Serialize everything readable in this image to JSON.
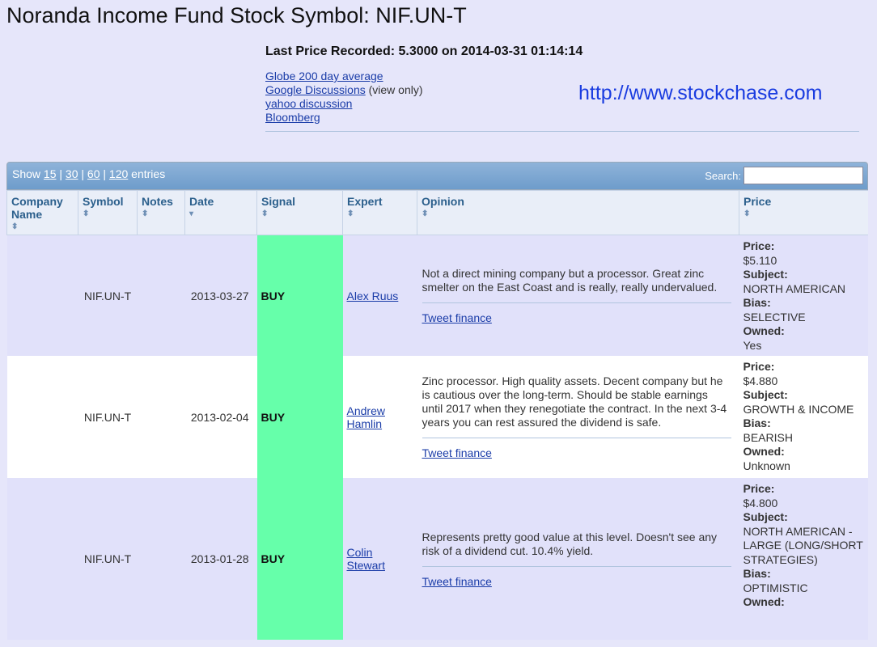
{
  "title": "Noranda Income Fund Stock Symbol: NIF.UN-T",
  "last_price": {
    "prefix": "Last Price Recorded: ",
    "value": "5.3000",
    "on": " on ",
    "datetime": "2014-03-31 01:14:14"
  },
  "links": {
    "globe": "Globe 200 day average",
    "google": "Google Discussions",
    "google_note": " (view only)",
    "yahoo": "yahoo discussion",
    "bloomberg": "Bloomberg"
  },
  "site_url": "http://www.stockchase.com",
  "toolbar": {
    "show_prefix": "Show ",
    "options": [
      "15",
      "30",
      "60",
      "120"
    ],
    "sep": " | ",
    "show_suffix": " entries",
    "search_label": "Search:",
    "search_value": ""
  },
  "columns": [
    "Company Name",
    "Symbol",
    "Notes",
    "Date",
    "Signal",
    "Expert",
    "Opinion",
    "Price"
  ],
  "icons": {
    "sort_both": "sort-both-icon",
    "sort_desc": "sort-desc-icon"
  },
  "labels": {
    "price": "Price:",
    "subject": "Subject:",
    "bias": "Bias:",
    "owned": "Owned:",
    "tweet": "Tweet finance"
  },
  "rows": [
    {
      "company": "",
      "symbol": "NIF.UN-T",
      "notes": "",
      "date": "2013-03-27",
      "signal": "BUY",
      "expert": "Alex Ruus",
      "opinion": "Not a direct mining company but a processor. Great zinc smelter on the East Coast and is really, really undervalued.",
      "price": "$5.110",
      "subject": "NORTH AMERICAN",
      "bias": "SELECTIVE",
      "owned": "Yes"
    },
    {
      "company": "",
      "symbol": "NIF.UN-T",
      "notes": "",
      "date": "2013-02-04",
      "signal": "BUY",
      "expert": "Andrew Hamlin",
      "opinion": "Zinc processor.  High quality assets.  Decent company but he is cautious over the long-term.  Should be stable earnings until 2017 when they renegotiate the contract.  In the next 3-4 years you can rest assured the dividend is safe.",
      "price": "$4.880",
      "subject": "GROWTH & INCOME",
      "bias": "BEARISH",
      "owned": "Unknown"
    },
    {
      "company": "",
      "symbol": "NIF.UN-T",
      "notes": "",
      "date": "2013-01-28",
      "signal": "BUY",
      "expert": "Colin Stewart",
      "opinion": "Represents pretty good value at this level. Doesn't see any risk of a dividend cut. 10.4% yield.",
      "price": "$4.800",
      "subject": "NORTH AMERICAN - LARGE (LONG/SHORT STRATEGIES)",
      "bias": "OPTIMISTIC",
      "owned": ""
    }
  ],
  "colors": {
    "signal_buy": "#66ffaa",
    "link": "#1a3ca8",
    "site_url": "#1a3ce0"
  }
}
